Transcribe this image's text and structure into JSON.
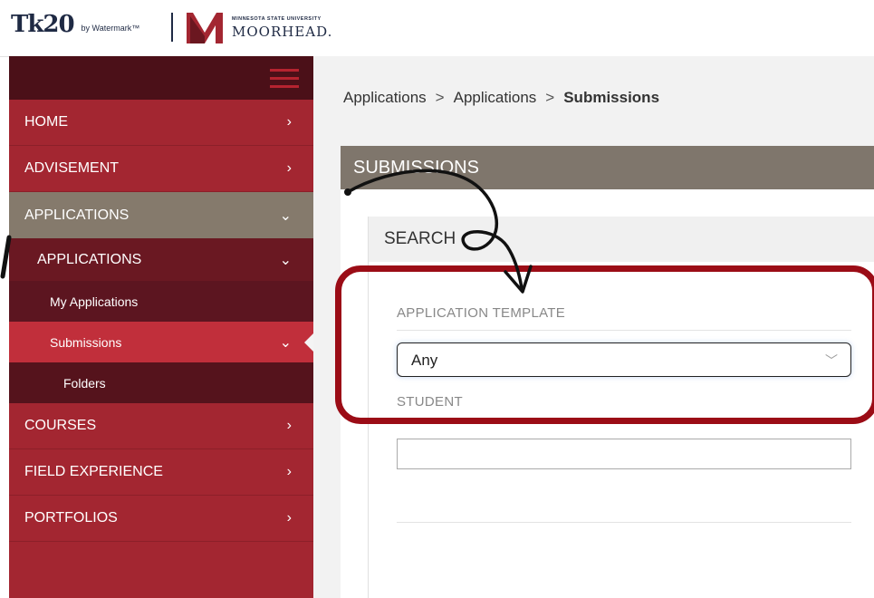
{
  "header": {
    "brand_logo": "Tk20",
    "brand_by": "by Watermark™",
    "university_small": "MINNESOTA STATE UNIVERSITY",
    "university_name": "MOORHEAD."
  },
  "sidebar": {
    "menu_icon": "hamburger-icon",
    "items": [
      {
        "label": "HOME"
      },
      {
        "label": "ADVISEMENT"
      },
      {
        "label": "APPLICATIONS"
      },
      {
        "label": "APPLICATIONS"
      },
      {
        "label": "My Applications"
      },
      {
        "label": "Submissions"
      },
      {
        "label": "Folders"
      },
      {
        "label": "COURSES"
      },
      {
        "label": "FIELD EXPERIENCE"
      },
      {
        "label": "PORTFOLIOS"
      }
    ]
  },
  "breadcrumb": {
    "items": [
      "Applications",
      "Applications",
      "Submissions"
    ],
    "separator": ">"
  },
  "page": {
    "section_title": "SUBMISSIONS",
    "search_title": "SEARCH",
    "template_label": "APPLICATION TEMPLATE",
    "template_value": "Any",
    "student_label": "STUDENT",
    "student_value": ""
  },
  "colors": {
    "sidebar": "#a32631",
    "sidebar_dark": "#4b1018",
    "sidebar_open": "#857a6c",
    "active_item": "#c12f3b",
    "section_header": "#7f766c",
    "highlight": "#9b0c16"
  }
}
